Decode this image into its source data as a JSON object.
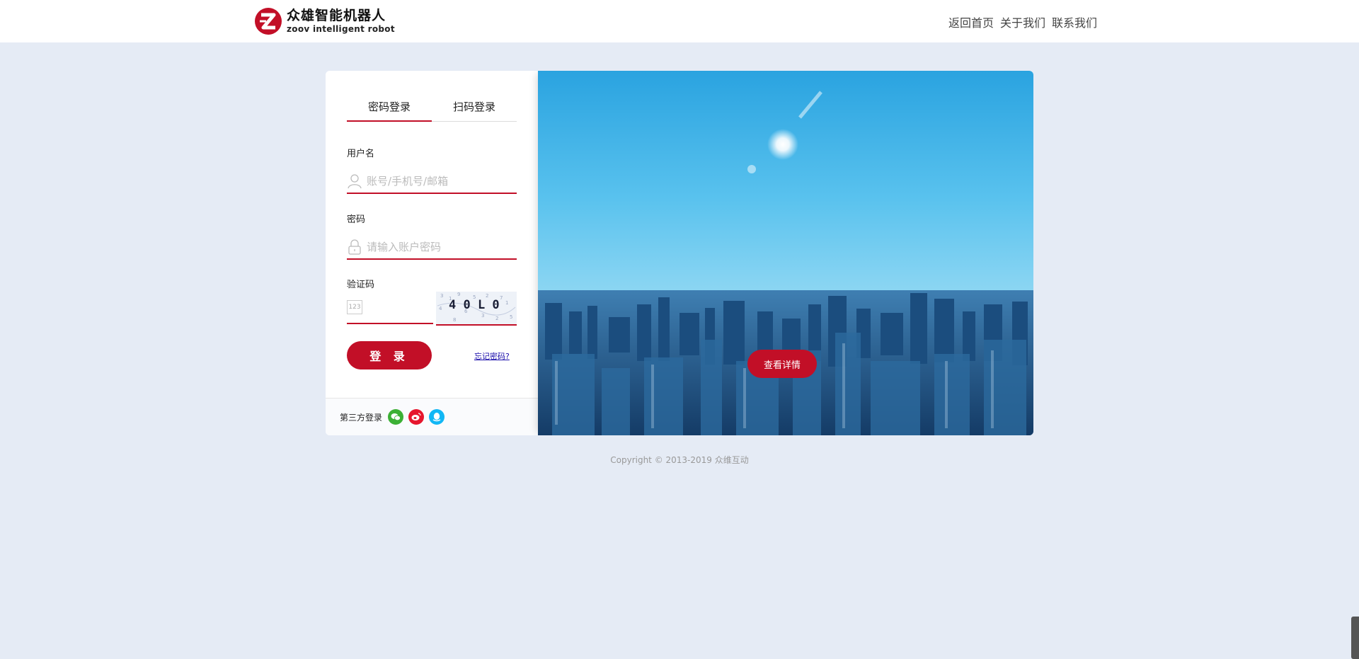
{
  "header": {
    "logo_cn": "众雄智能机器人",
    "logo_en": "zoov intelligent robot",
    "nav": [
      "返回首页",
      "关于我们",
      "联系我们"
    ]
  },
  "login": {
    "tabs": [
      {
        "label": "密码登录",
        "active": true
      },
      {
        "label": "扫码登录",
        "active": false
      }
    ],
    "username_label": "用户名",
    "username_placeholder": "账号/手机号/邮箱",
    "password_label": "密码",
    "password_placeholder": "请输入账户密码",
    "captcha_label": "验证码",
    "captcha_hint": "123",
    "captcha_text": "4 0 L 0",
    "submit_label": "登 录",
    "forgot_label": "忘记密码?",
    "third_party_label": "第三方登录",
    "third_party_icons": [
      "wechat-icon",
      "weibo-icon",
      "qq-icon"
    ]
  },
  "banner": {
    "detail_button": "查看详情"
  },
  "footer": {
    "copyright": "Copyright © 2013-2019 众维互动"
  },
  "colors": {
    "accent": "#c20f27",
    "background": "#e5ebf5"
  }
}
